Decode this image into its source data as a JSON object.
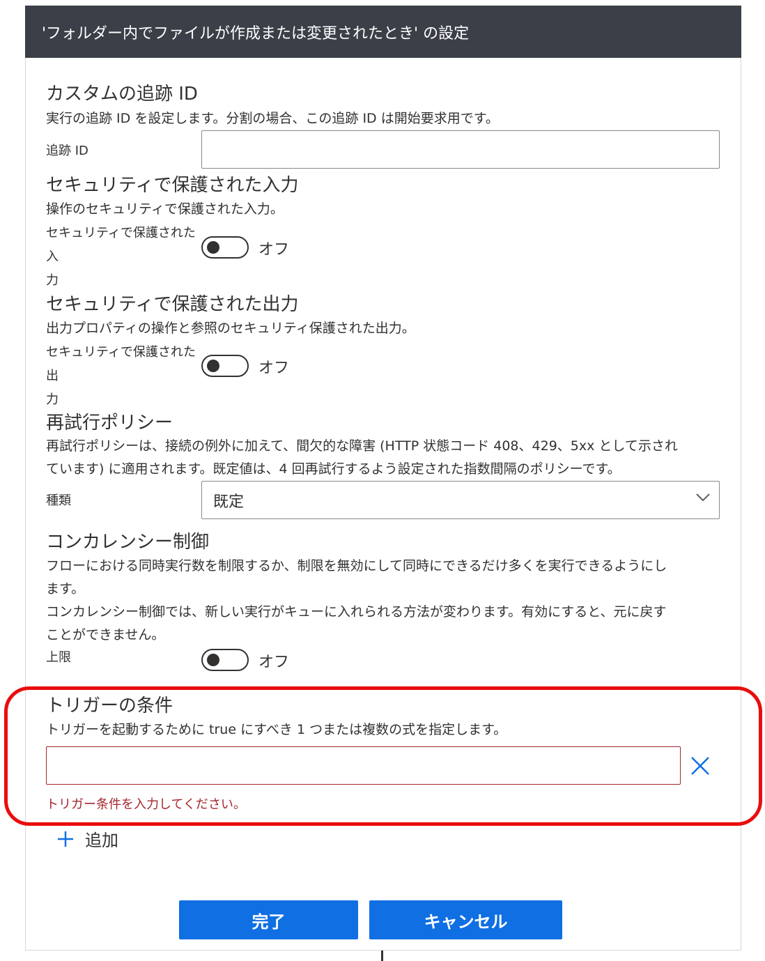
{
  "dialog_title": "'フォルダー内でファイルが作成または変更されたとき' の設定",
  "tracking": {
    "heading": "カスタムの追跡 ID",
    "description": "実行の追跡 ID を設定します。分割の場合、この追跡 ID は開始要求用です。",
    "field_label": "追跡 ID",
    "value": ""
  },
  "secure_input": {
    "heading": "セキュリティで保護された入力",
    "description": "操作のセキュリティで保護された入力。",
    "field_label_line1": "セキュリティで保護された入",
    "field_label_line2": "力",
    "state": "オフ"
  },
  "secure_output": {
    "heading": "セキュリティで保護された出力",
    "description": "出力プロパティの操作と参照のセキュリティ保護された出力。",
    "field_label_line1": "セキュリティで保護された出",
    "field_label_line2": "力",
    "state": "オフ"
  },
  "retry_policy": {
    "heading": "再試行ポリシー",
    "description_line1": "再試行ポリシーは、接続の例外に加えて、間欠的な障害 (HTTP 状態コード 408、429、5xx として示され",
    "description_line2": "ています) に適用されます。既定値は、4 回再試行するよう設定された指数間隔のポリシーです。",
    "field_label": "種類",
    "selected": "既定"
  },
  "concurrency": {
    "heading": "コンカレンシー制御",
    "description_line1": "フローにおける同時実行数を制限するか、制限を無効にして同時にできるだけ多くを実行できるようにし",
    "description_line2": "ます。",
    "description_line3": "コンカレンシー制御では、新しい実行がキューに入れられる方法が変わります。有効にすると、元に戻す",
    "description_line4": "ことができません。",
    "field_label": "上限",
    "state": "オフ"
  },
  "trigger_conditions": {
    "heading": "トリガーの条件",
    "description": "トリガーを起動するために true にすべき 1 つまたは複数の式を指定します。",
    "value": "",
    "error": "トリガー条件を入力してください。",
    "add_label": "追加"
  },
  "buttons": {
    "done": "完了",
    "cancel": "キャンセル"
  },
  "colors": {
    "titlebar": "#3b3f47",
    "primary_button": "#0f6fe3",
    "highlight": "#ea0d0d",
    "error": "#a4262c",
    "accent_icon": "#0f6fe3"
  }
}
